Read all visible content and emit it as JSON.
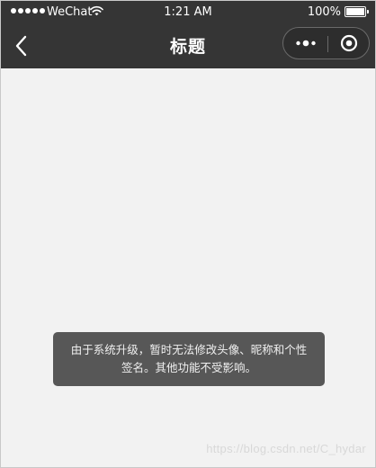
{
  "status_bar": {
    "carrier": "WeChat",
    "time": "1:21 AM",
    "battery": "100%"
  },
  "nav": {
    "title": "标题"
  },
  "toast": {
    "message": "由于系统升级，暂时无法修改头像、昵称和个性签名。其他功能不受影响。"
  },
  "watermark": "https://blog.csdn.net/C_hydar",
  "colors": {
    "header_bg": "#353535",
    "page_bg": "#f2f2f2",
    "toast_bg": "#575757"
  }
}
